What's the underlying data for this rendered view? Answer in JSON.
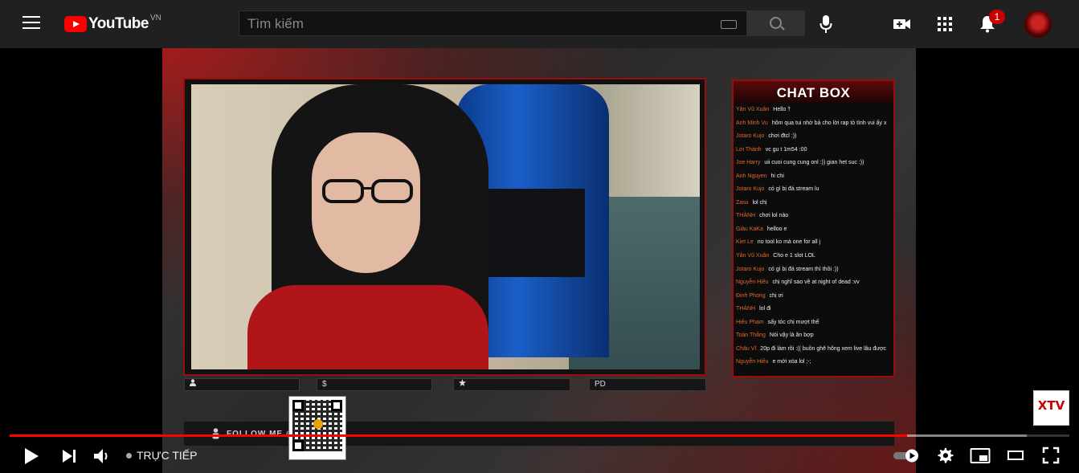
{
  "header": {
    "logo_text": "YouTube",
    "country_code": "VN",
    "search_placeholder": "Tìm kiếm",
    "notification_count": "1"
  },
  "stream": {
    "chat_title": "CHAT BOX",
    "chat": [
      {
        "user": "Yân Vũ Xuân",
        "msg": "Hello †"
      },
      {
        "user": "Anh Minh Vu",
        "msg": "hôm qua tui nhờ bả cho lời rap tỏ tình vui ấy x"
      },
      {
        "user": "Jotaro Kujo",
        "msg": "chơi đtcl :))"
      },
      {
        "user": "Lơi Thành",
        "msg": "vc gu t 1m54 :00"
      },
      {
        "user": "Joe Harry",
        "msg": "uii cuoi cung cung onl :)) gian het suc :))"
      },
      {
        "user": "Anh Nguyen",
        "msg": "hi chi"
      },
      {
        "user": "Jotaro Kujo",
        "msg": "có gì bị đá stream lu"
      },
      {
        "user": "Zasu",
        "msg": "lol chị"
      },
      {
        "user": "THÀNH",
        "msg": "chơi lol nào"
      },
      {
        "user": "Giàu KaKa",
        "msg": "helloo e"
      },
      {
        "user": "Kiet Le",
        "msg": "no tool ko mà one for all j"
      },
      {
        "user": "Yân Vũ Xuân",
        "msg": "Cho e 1 slot LOL"
      },
      {
        "user": "Jotaro Kujo",
        "msg": "có gì bị đá stream thì thôi :))"
      },
      {
        "user": "Nguyễn Hiếu",
        "msg": "chị nghĩ sao về at night of dead :vv"
      },
      {
        "user": "Đinh Phong",
        "msg": "chị ơi"
      },
      {
        "user": "THÀNH",
        "msg": "lol đi"
      },
      {
        "user": "Hiếu Phạm",
        "msg": "sấy tóc chị mượt thế"
      },
      {
        "user": "Toàn Thắng",
        "msg": "Nói vậy là ăn bợp"
      },
      {
        "user": "Châu Vĩ",
        "msg": "20p đi làm rồi :(( buồn ghê hông xem live lâu được"
      },
      {
        "user": "Nguyễn Hiếu",
        "msg": "e mới xóa lol ;-;"
      }
    ],
    "follow_text": "FOLLOW ME @",
    "info_bar_symbols": [
      "$",
      "PD"
    ],
    "watermark": "XTV"
  },
  "controls": {
    "live_label": "TRỰC TIẾP",
    "played_fraction": 0.847,
    "loaded_fraction": 0.96
  }
}
